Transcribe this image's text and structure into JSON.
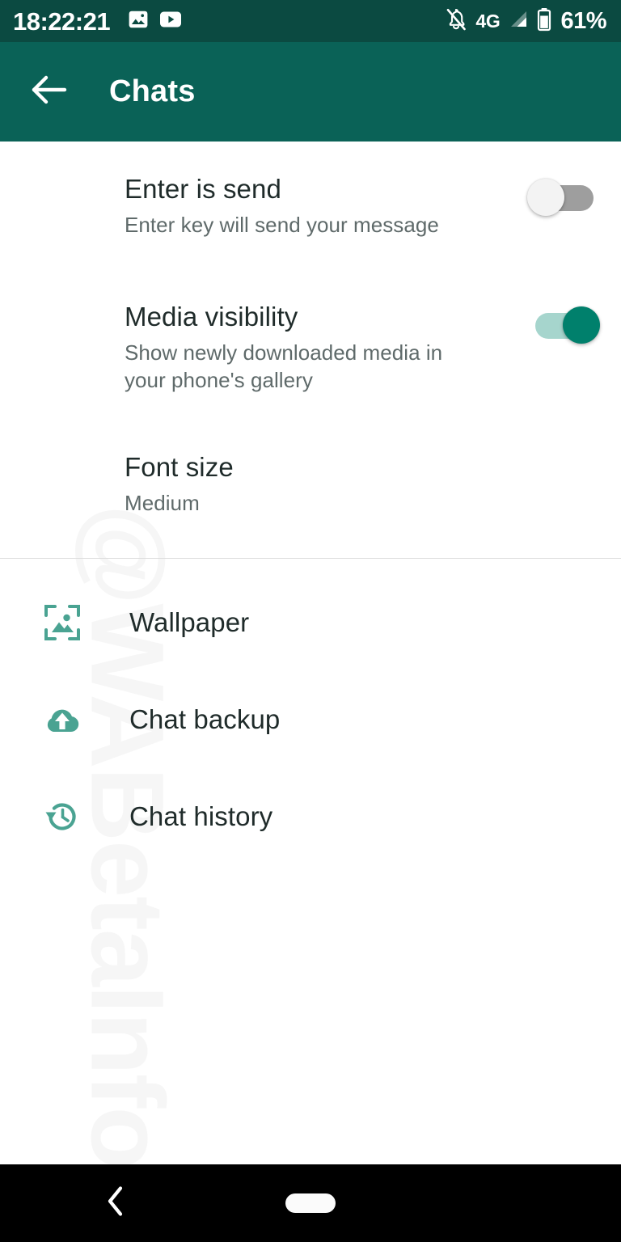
{
  "theme": {
    "status_bar_bg": "#0b4a41",
    "app_bar_bg": "#0a6257",
    "accent": "#00806c",
    "accent_light": "#a6d5cd",
    "icon_teal": "#4aa392",
    "title_color": "#1f2b2a",
    "subtitle_color": "#5f6a6a",
    "nav_bar_bg": "#000000"
  },
  "status_bar": {
    "clock": "18:22:21",
    "left_icons": [
      "photo-icon",
      "youtube-icon"
    ],
    "notification_state": "silent",
    "network_type": "4G",
    "signal_icon": "signal-bars-icon",
    "battery_icon": "battery-icon",
    "battery_percent": "61%"
  },
  "app_bar": {
    "back_icon": "arrow-left-icon",
    "title": "Chats"
  },
  "settings": {
    "toggle_rows": [
      {
        "key": "enter_is_send",
        "title": "Enter is send",
        "subtitle": "Enter key will send your message",
        "state": "off",
        "state_label": "Off"
      },
      {
        "key": "media_visibility",
        "title": "Media visibility",
        "subtitle": "Show newly downloaded media in your phone's gallery",
        "state": "on",
        "state_label": "On"
      }
    ],
    "value_rows": [
      {
        "key": "font_size",
        "title": "Font size",
        "subtitle": "Medium"
      }
    ],
    "link_rows": [
      {
        "key": "wallpaper",
        "icon": "wallpaper-icon",
        "label": "Wallpaper"
      },
      {
        "key": "chat_backup",
        "icon": "cloud-upload-icon",
        "label": "Chat backup"
      },
      {
        "key": "chat_history",
        "icon": "history-clock-icon",
        "label": "Chat history"
      }
    ]
  },
  "watermark": {
    "text": "@WABetaInfo"
  },
  "nav_bar": {
    "back_icon": "chevron-left-icon",
    "home_indicator": "home-pill"
  }
}
